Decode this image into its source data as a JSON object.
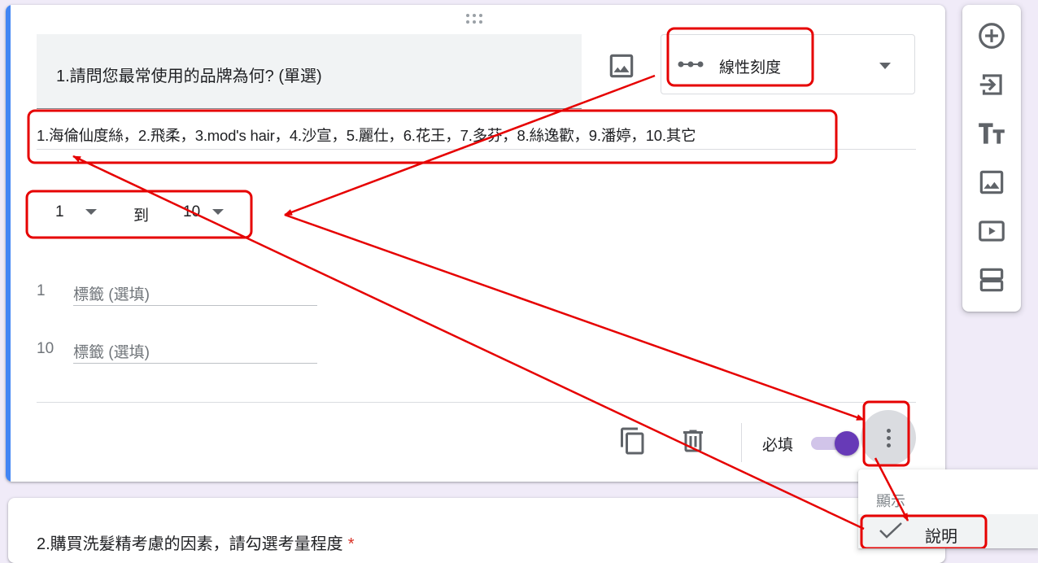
{
  "question": {
    "title": "1.請問您最常使用的品牌為何?  (單選)",
    "type_label": "線性刻度",
    "description": "1.海倫仙度絲，2.飛柔，3.mod's hair，4.沙宣，5.麗仕，6.花王，7.多芬，8.絲逸歡，9.潘婷，10.其它",
    "scale": {
      "from": "1",
      "to_word": "到",
      "to": "10"
    },
    "labels": [
      {
        "num": "1",
        "placeholder": "標籤 (選填)"
      },
      {
        "num": "10",
        "placeholder": "標籤 (選填)"
      }
    ],
    "required_label": "必填",
    "required": true
  },
  "next_question": {
    "title": "2.購買洗髮精考慮的因素，請勾選考量程度",
    "required_mark": "*"
  },
  "toolbar": {
    "icons": [
      "add-question-icon",
      "import-questions-icon",
      "add-title-icon",
      "add-image-icon",
      "add-video-icon",
      "add-section-icon"
    ]
  },
  "menu": {
    "header": "顯示",
    "item": "說明",
    "item_checked": true
  },
  "colors": {
    "accent": "#4285f4",
    "toggle": "#673ab7",
    "annotation": "#e60000",
    "required_star": "#d93025"
  }
}
